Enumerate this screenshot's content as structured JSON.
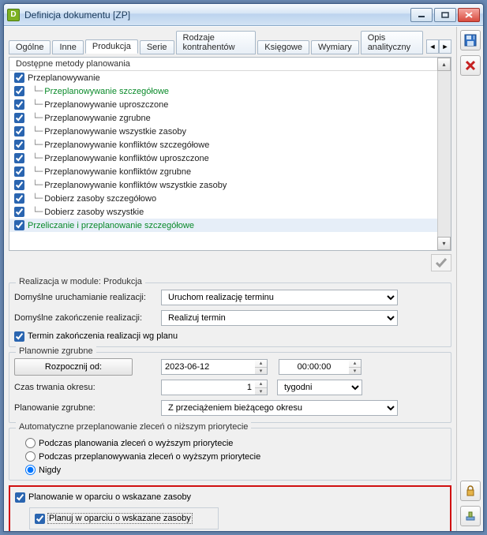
{
  "window": {
    "app_icon_letter": "D",
    "title": "Definicja dokumentu [ZP]"
  },
  "tabs": {
    "items": [
      "Ogólne",
      "Inne",
      "Produkcja",
      "Serie",
      "Rodzaje kontrahentów",
      "Księgowe",
      "Wymiary",
      "Opis analityczny"
    ],
    "active_index": 2,
    "nav_left": "◄",
    "nav_right": "►"
  },
  "tree": {
    "header": "Dostępne metody planowania",
    "items": [
      {
        "level": 1,
        "checked": true,
        "label": "Przeplanowywanie",
        "green": false,
        "selected": false
      },
      {
        "level": 2,
        "checked": true,
        "label": "Przeplanowywanie szczegółowe",
        "green": true,
        "selected": false
      },
      {
        "level": 2,
        "checked": true,
        "label": "Przeplanowywanie uproszczone",
        "green": false,
        "selected": false
      },
      {
        "level": 2,
        "checked": true,
        "label": "Przeplanowywanie zgrubne",
        "green": false,
        "selected": false
      },
      {
        "level": 2,
        "checked": true,
        "label": "Przeplanowywanie wszystkie zasoby",
        "green": false,
        "selected": false
      },
      {
        "level": 2,
        "checked": true,
        "label": "Przeplanowywanie konfliktów szczegółowe",
        "green": false,
        "selected": false
      },
      {
        "level": 2,
        "checked": true,
        "label": "Przeplanowywanie konfliktów uproszczone",
        "green": false,
        "selected": false
      },
      {
        "level": 2,
        "checked": true,
        "label": "Przeplanowywanie konfliktów zgrubne",
        "green": false,
        "selected": false
      },
      {
        "level": 2,
        "checked": true,
        "label": "Przeplanowywanie konfliktów wszystkie zasoby",
        "green": false,
        "selected": false
      },
      {
        "level": 2,
        "checked": true,
        "label": "Dobierz zasoby szczegółowo",
        "green": false,
        "selected": false
      },
      {
        "level": 2,
        "checked": true,
        "label": "Dobierz zasoby wszystkie",
        "green": false,
        "selected": false
      },
      {
        "level": 1,
        "checked": true,
        "label": "Przeliczanie i przeplanowanie szczegółowe",
        "green": true,
        "selected": true
      }
    ]
  },
  "realization": {
    "legend": "Realizacja w module: Produkcja",
    "start_label": "Domyślne uruchamianie realizacji:",
    "start_value": "Uruchom realizację terminu",
    "end_label": "Domyślne zakończenie realizacji:",
    "end_value": "Realizuj termin",
    "chk_label": "Termin zakończenia realizacji wg planu",
    "chk_checked": true
  },
  "coarse": {
    "legend": "Planownie zgrubne",
    "btn_label": "Rozpocznij od:",
    "date": "2023-06-12",
    "time": "00:00:00",
    "duration_label": "Czas trwania okresu:",
    "duration_value": "1",
    "unit": "tygodni",
    "mode_label": "Planowanie zgrubne:",
    "mode_value": "Z przeciążeniem bieżącego okresu"
  },
  "auto": {
    "legend": "Automatyczne przeplanowanie zleceń o niższym priorytecie",
    "radios": [
      {
        "label": "Podczas planowania zleceń o wyższym priorytecie",
        "checked": false
      },
      {
        "label": "Podczas przeplanowywania zleceń o wyższym priorytecie",
        "checked": false
      },
      {
        "label": "Nigdy",
        "checked": true
      }
    ]
  },
  "highlight": {
    "outer_label": "Planowanie w oparciu o wskazane zasoby",
    "outer_checked": true,
    "inner_label": "Planuj w oparciu o wskazane zasoby",
    "inner_checked": true
  }
}
